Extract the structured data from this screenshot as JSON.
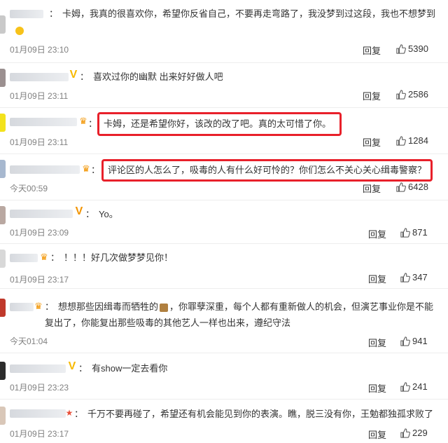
{
  "comments": [
    {
      "text": "卡姆，我真的很喜欢你，希望你反省自己，不要再走弯路了，我没梦到过这段，我也不想梦到",
      "time": "01月09日 23:10",
      "reply": "回复",
      "likes": "5390"
    },
    {
      "text": "喜欢过你的幽默 出来好好做人吧",
      "time": "01月09日 23:11",
      "reply": "回复",
      "likes": "2586"
    },
    {
      "text": "卡姆，还是希望你好，该改的改了吧。真的太可惜了你。",
      "time": "01月09日 23:11",
      "reply": "回复",
      "likes": "1284"
    },
    {
      "text": "评论区的人怎么了，吸毒的人有什么好可怜的？你们怎么不关心关心缉毒警察？",
      "time": "今天00:59",
      "reply": "回复",
      "likes": "6428"
    },
    {
      "text": "Yo。",
      "time": "01月09日 23:09",
      "reply": "回复",
      "likes": "871"
    },
    {
      "text": "！！！好几次做梦梦见你！",
      "time": "01月09日 23:17",
      "reply": "回复",
      "likes": "347"
    },
    {
      "text": "想想那些因缉毒而牺牲的",
      "text_after": "，你罪孽深重，每个人都有重新做人的机会，但演艺事业你是不能复出了，你能复出那些吸毒的其他艺人一样也出来，遵纪守法",
      "time": "今天01:04",
      "reply": "回复",
      "likes": "941"
    },
    {
      "text": "有show一定去看你",
      "time": "01月09日 23:23",
      "reply": "回复",
      "likes": "241"
    },
    {
      "text": "千万不要再碰了，希望还有机会能见到你的表演。瞧，脱三没有你，王勉都独孤求败了",
      "time": "01月09日 23:17",
      "reply": "回复",
      "likes": "229"
    }
  ],
  "colon": "：",
  "icons": {
    "like": "thumbs-up-icon",
    "vip": "vip-v-badge-icon",
    "crown": "crown-badge-icon"
  },
  "colors": {
    "highlight": "#e8202a",
    "time": "#808080",
    "text": "#333333"
  }
}
